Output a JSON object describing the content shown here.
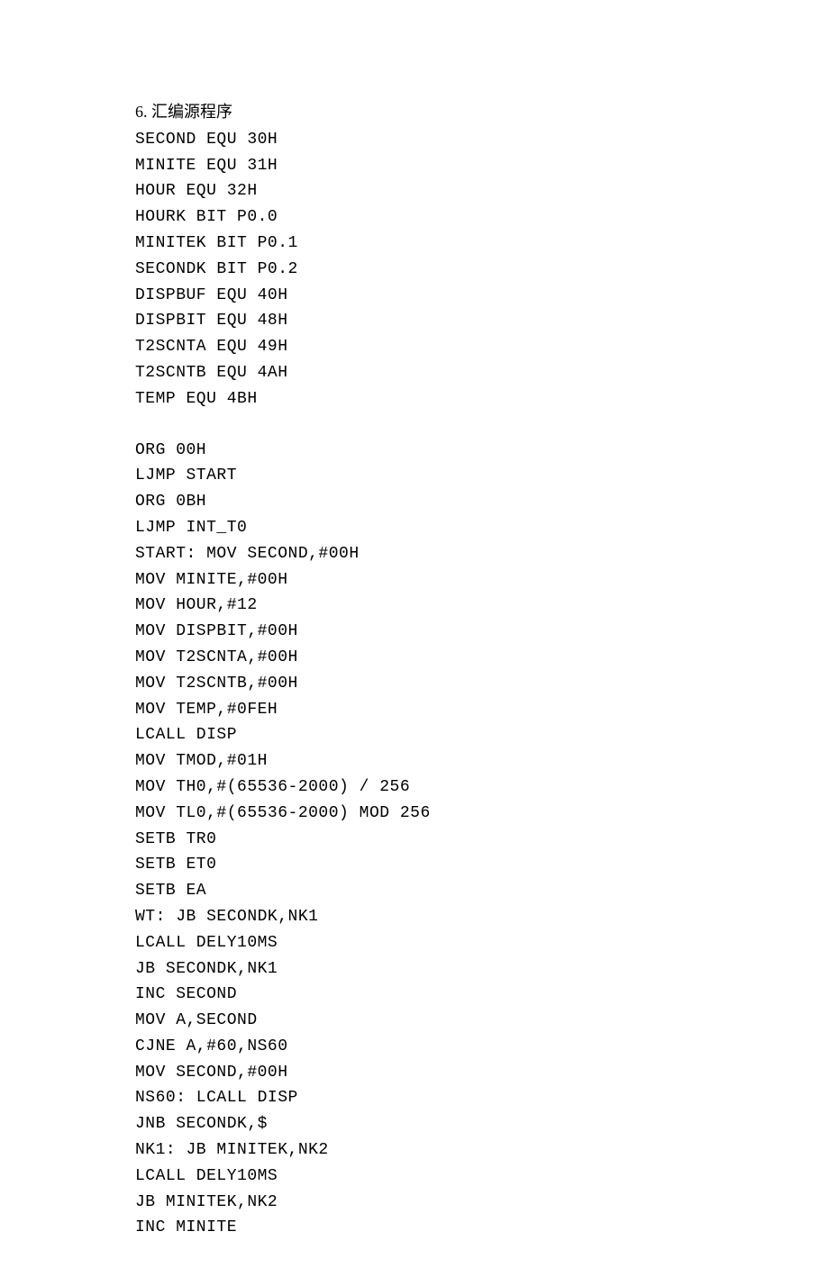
{
  "heading": "6.  汇编源程序",
  "code_lines": [
    "SECOND EQU 30H",
    "MINITE EQU 31H",
    "HOUR EQU 32H",
    "HOURK BIT P0.0",
    "MINITEK BIT P0.1",
    "SECONDK BIT P0.2",
    "DISPBUF EQU 40H",
    "DISPBIT EQU 48H",
    "T2SCNTA EQU 49H",
    "T2SCNTB EQU 4AH",
    "TEMP EQU 4BH",
    "",
    "ORG 00H",
    "LJMP START",
    "ORG 0BH",
    "LJMP INT_T0",
    "START: MOV SECOND,#00H",
    "MOV MINITE,#00H",
    "MOV HOUR,#12",
    "MOV DISPBIT,#00H",
    "MOV T2SCNTA,#00H",
    "MOV T2SCNTB,#00H",
    "MOV TEMP,#0FEH",
    "LCALL DISP",
    "MOV TMOD,#01H",
    "MOV TH0,#(65536-2000) / 256",
    "MOV TL0,#(65536-2000) MOD 256",
    "SETB TR0",
    "SETB ET0",
    "SETB EA",
    "WT: JB SECONDK,NK1",
    "LCALL DELY10MS",
    "JB SECONDK,NK1",
    "INC SECOND",
    "MOV A,SECOND",
    "CJNE A,#60,NS60",
    "MOV SECOND,#00H",
    "NS60: LCALL DISP",
    "JNB SECONDK,$",
    "NK1: JB MINITEK,NK2",
    "LCALL DELY10MS",
    "JB MINITEK,NK2",
    "INC MINITE"
  ]
}
